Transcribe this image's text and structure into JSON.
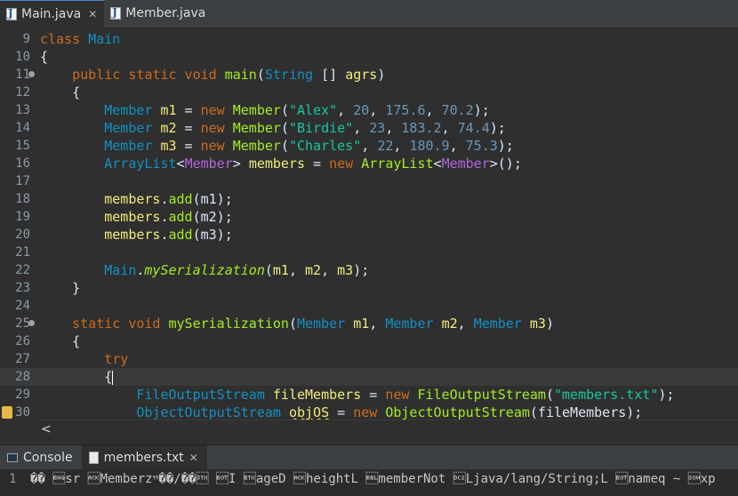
{
  "editor_tabs": [
    {
      "label": "Main.java",
      "active": true,
      "close": "✕"
    },
    {
      "label": "Member.java",
      "active": false
    }
  ],
  "lines": {
    "l9": "9",
    "l10": "10",
    "l11": "11",
    "l12": "12",
    "l13": "13",
    "l14": "14",
    "l15": "15",
    "l16": "16",
    "l17": "17",
    "l18": "18",
    "l19": "19",
    "l20": "20",
    "l21": "21",
    "l22": "22",
    "l23": "23",
    "l24": "24",
    "l25": "25",
    "l26": "26",
    "l27": "27",
    "l28": "28",
    "l29": "29",
    "l30": "30"
  },
  "code": {
    "c9": {
      "kw": "class",
      "name": "Main"
    },
    "c10": "{",
    "c11": {
      "kw": "public static void",
      "fn": "main",
      "p1": "(",
      "type": "String",
      "p2": " [] ",
      "var": "agrs",
      "p3": ")"
    },
    "c12": "{",
    "c13": {
      "type": "Member",
      "var": "m1",
      "eq": " = ",
      "kw": "new",
      "ctor": "Member",
      "open": "(",
      "str": "\"Alex\"",
      "c1": ", ",
      "n1": "20",
      "c2": ", ",
      "n2": "175.6",
      "c3": ", ",
      "n3": "70.2",
      "close": ");"
    },
    "c14": {
      "type": "Member",
      "var": "m2",
      "eq": " = ",
      "kw": "new",
      "ctor": "Member",
      "open": "(",
      "str": "\"Birdie\"",
      "c1": ", ",
      "n1": "23",
      "c2": ", ",
      "n2": "183.2",
      "c3": ", ",
      "n3": "74.4",
      "close": ");"
    },
    "c15": {
      "type": "Member",
      "var": "m3",
      "eq": " = ",
      "kw": "new",
      "ctor": "Member",
      "open": "(",
      "str": "\"Charles\"",
      "c1": ", ",
      "n1": "22",
      "c2": ", ",
      "n2": "180.9",
      "c3": ", ",
      "n3": "75.3",
      "close": ");"
    },
    "c16": {
      "type": "ArrayList",
      "lt": "<",
      "gen": "Member",
      "gt": ">",
      "var": "members",
      "eq": " = ",
      "kw": "new",
      "ctor": "ArrayList",
      "lt2": "<",
      "gen2": "Member",
      "gt2": ">",
      "close": "();"
    },
    "c18": {
      "var": "members",
      "dot": ".",
      "fn": "add",
      "args": "(m1);"
    },
    "c19": {
      "var": "members",
      "dot": ".",
      "fn": "add",
      "args": "(m2);"
    },
    "c20": {
      "var": "members",
      "dot": ".",
      "fn": "add",
      "args": "(m3);"
    },
    "c22": {
      "type": "Main",
      "dot": ".",
      "fn": "mySerialization",
      "open": "(",
      "a1": "m1",
      "c1": ", ",
      "a2": "m2",
      "c2": ", ",
      "a3": "m3",
      "close": ");"
    },
    "c23": "}",
    "c25": {
      "kw": "static void",
      "fn": "mySerialization",
      "open": "(",
      "t1": "Member",
      "v1": "m1",
      "c1": ", ",
      "t2": "Member",
      "v2": "m2",
      "c2": ", ",
      "t3": "Member",
      "v3": "m3",
      "close": ")"
    },
    "c26": "{",
    "c27": "try",
    "c28": "{",
    "c29": {
      "type": "FileOutputStream",
      "var": "fileMembers",
      "eq": " = ",
      "kw": "new",
      "ctor": "FileOutputStream",
      "open": "(",
      "str": "\"members.txt\"",
      "close": ");"
    },
    "c30": {
      "type": "ObjectOutputStream",
      "var": "objOS",
      "eq": " = ",
      "kw": "new",
      "ctor": "ObjectOutputStream",
      "args": "(fileMembers);"
    }
  },
  "scroll_left": "<",
  "console_tabs": [
    {
      "label": "Console",
      "active": false
    },
    {
      "label": "members.txt",
      "active": true,
      "close": "✕"
    }
  ],
  "console_output": {
    "line_no": "1",
    "text": "�� \u0005sr \u0006Memberzײ��/��\u0002 \u0004I \u0003ageD \u0006heightL \u0007memberNot \u0012Ljava/lang/String;L \u0004nameq ~ \u0001xp"
  }
}
